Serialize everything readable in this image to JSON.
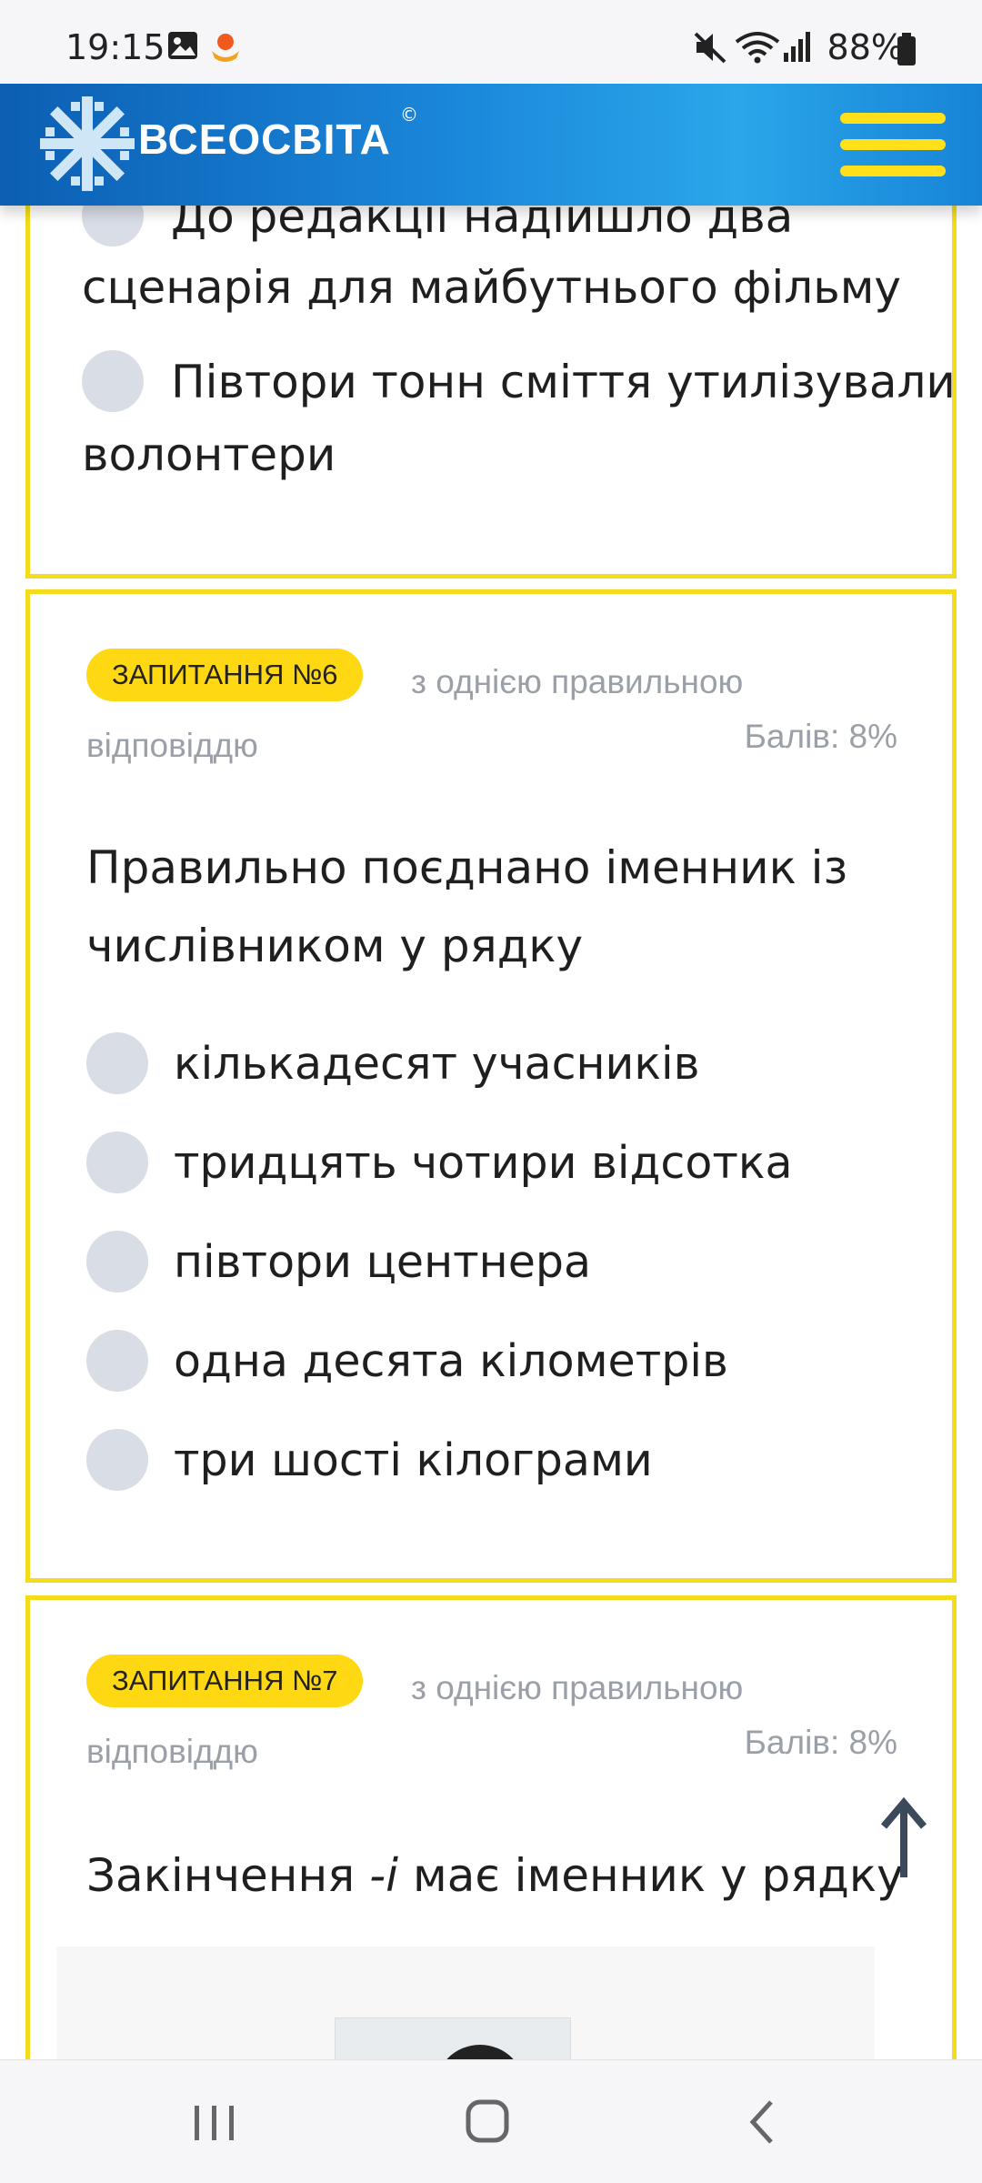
{
  "status_bar": {
    "time": "19:15",
    "battery": "88%",
    "icons": [
      "gallery-icon",
      "app-notification-icon",
      "mute-icon",
      "wifi-icon",
      "signal-icon",
      "battery-icon"
    ]
  },
  "header": {
    "logo_text": "ВСЕОСВІТА",
    "logo_copyright": "©",
    "brand_color": "#1a86d9",
    "menu_color": "#ffe01a"
  },
  "previous_question": {
    "options": [
      {
        "line1": "До редакції надійшло два",
        "line2": "сценарія для майбутнього фільму"
      },
      {
        "line1": "Півтори тонн сміття утилізували",
        "line2": "волонтери"
      }
    ]
  },
  "question6": {
    "badge": "ЗАПИТАННЯ №6",
    "type_line1": "з однією правильною",
    "type_line2": "відповіддю",
    "score": "Балів: 8%",
    "text_line1": "Правильно поєднано іменник із",
    "text_line2": "числівником у рядку",
    "options": [
      {
        "label": "кількадесят учасників"
      },
      {
        "label": "тридцять чотири відсотка"
      },
      {
        "label": "півтори центнера"
      },
      {
        "label": "одна десята кілометрів"
      },
      {
        "label": "три шості кілограми"
      }
    ]
  },
  "question7": {
    "badge": "ЗАПИТАННЯ №7",
    "type_line1": "з однією правильною",
    "type_line2": "відповіддю",
    "score": "Балів: 8%",
    "text_before": "Закінчення ",
    "text_italic": "-і",
    "text_after": " має іменник у рядку"
  },
  "colors": {
    "card_border": "#f2dc1c",
    "badge_bg": "#ffd814",
    "radio": "#d8dde6",
    "muted_text": "#9ba0a8"
  }
}
